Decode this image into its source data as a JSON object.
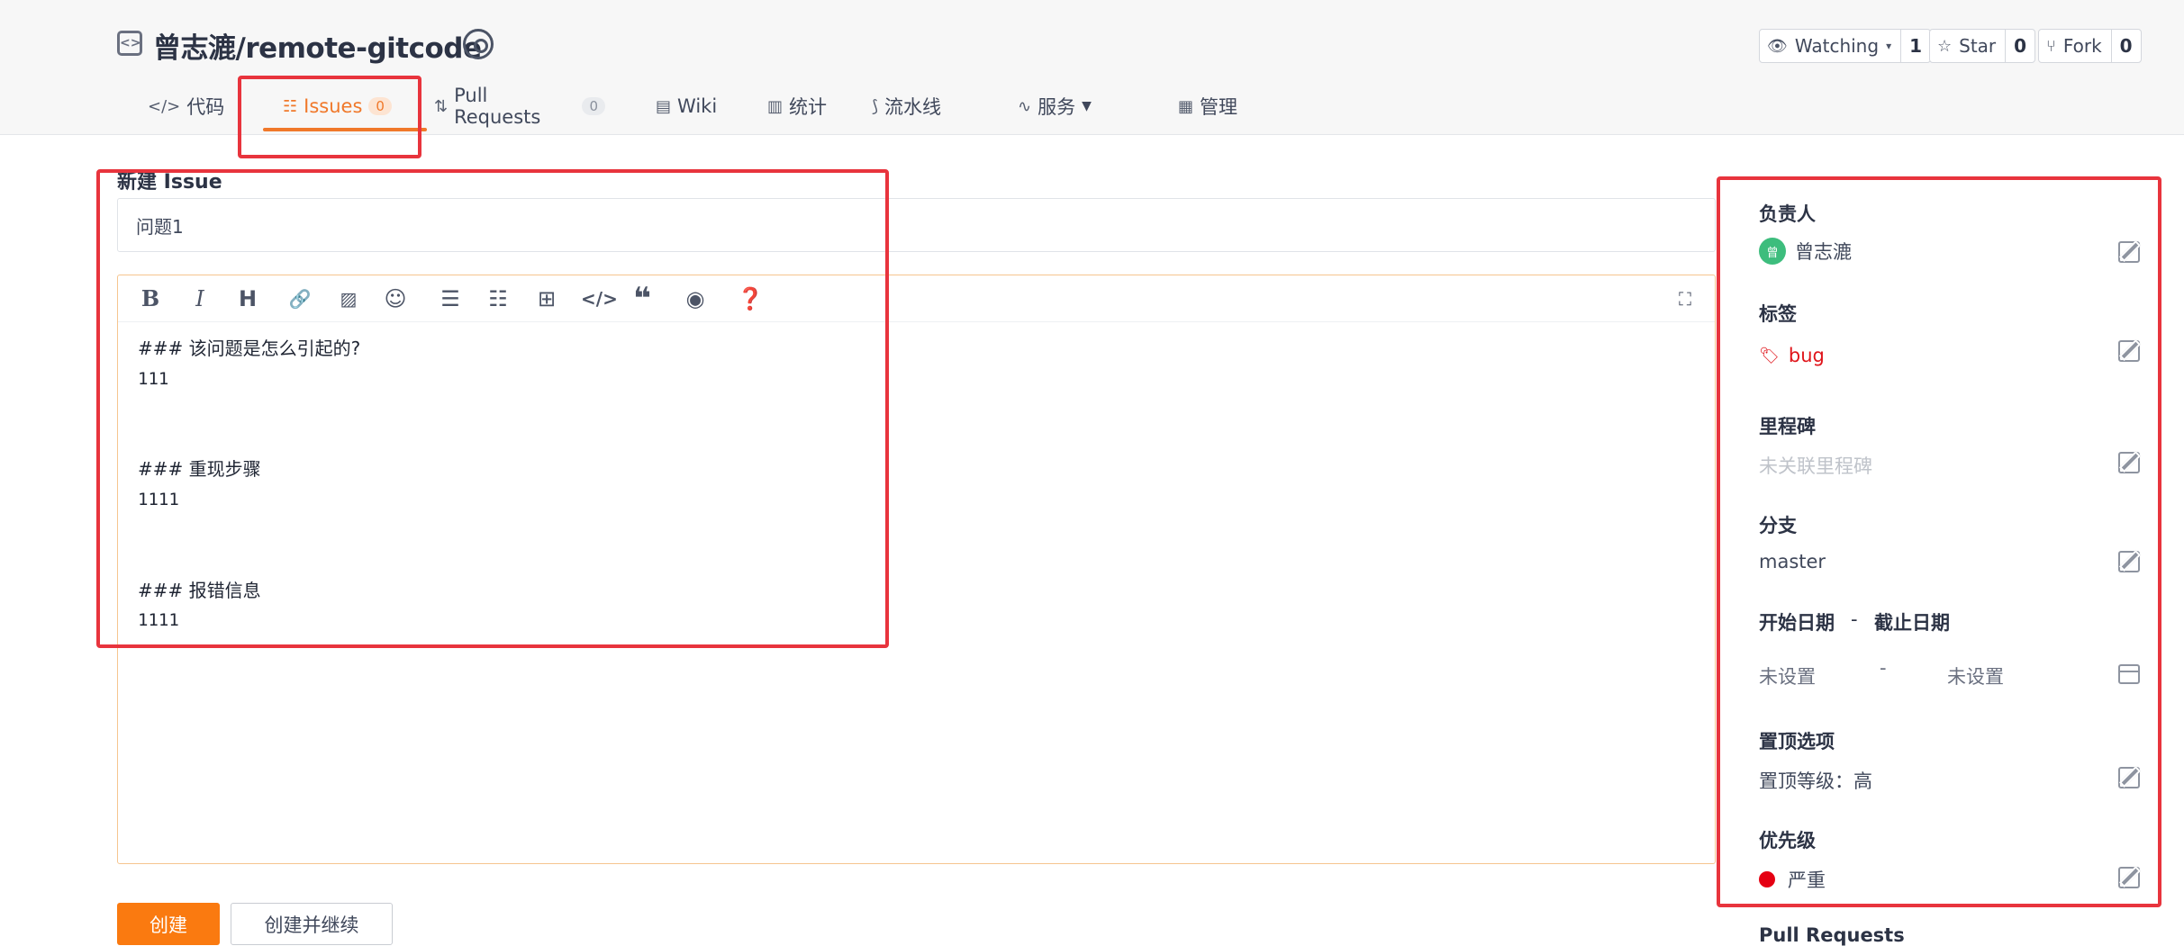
{
  "repo": {
    "title": "曾志漉/remote-gitcode"
  },
  "actions": [
    {
      "label": "Watching",
      "count": "1"
    },
    {
      "label": "Star",
      "count": "0"
    },
    {
      "label": "Fork",
      "count": "0"
    }
  ],
  "tabs": [
    {
      "label": "代码"
    },
    {
      "label": "Issues",
      "count": "0"
    },
    {
      "label": "Pull Requests",
      "count": "0"
    },
    {
      "label": "Wiki"
    },
    {
      "label": "统计"
    },
    {
      "label": "流水线"
    },
    {
      "label": "服务"
    },
    {
      "label": "管理"
    }
  ],
  "form": {
    "heading": "新建 Issue",
    "title_value": "问题1",
    "content_lines": [
      "### 该问题是怎么引起的?",
      "111",
      "",
      "",
      "### 重现步骤",
      "1111",
      "",
      "",
      "### 报错信息",
      "1111"
    ]
  },
  "buttons": {
    "create": "创建",
    "create_continue": "创建并继续"
  },
  "sidebar": {
    "assignee": {
      "label": "负责人",
      "value": "曾志漉",
      "avatar": "曾"
    },
    "labels": {
      "label": "标签",
      "value": "bug"
    },
    "milestone": {
      "label": "里程碑",
      "value": "未关联里程碑"
    },
    "branch": {
      "label": "分支",
      "value": "master"
    },
    "dates": {
      "start_label": "开始日期",
      "sep": "-",
      "end_label": "截止日期",
      "start_value": "未设置",
      "end_value": "未设置"
    },
    "pin": {
      "label": "置顶选项",
      "value": "置顶等级：高"
    },
    "priority": {
      "label": "优先级",
      "value": "严重"
    },
    "pull_requests": {
      "label": "Pull Requests"
    }
  },
  "colors": {
    "accent": "#f0782a",
    "highlight_box": "#e8343d",
    "priority_critical": "#e50012",
    "label_bug": "#e0151b"
  }
}
